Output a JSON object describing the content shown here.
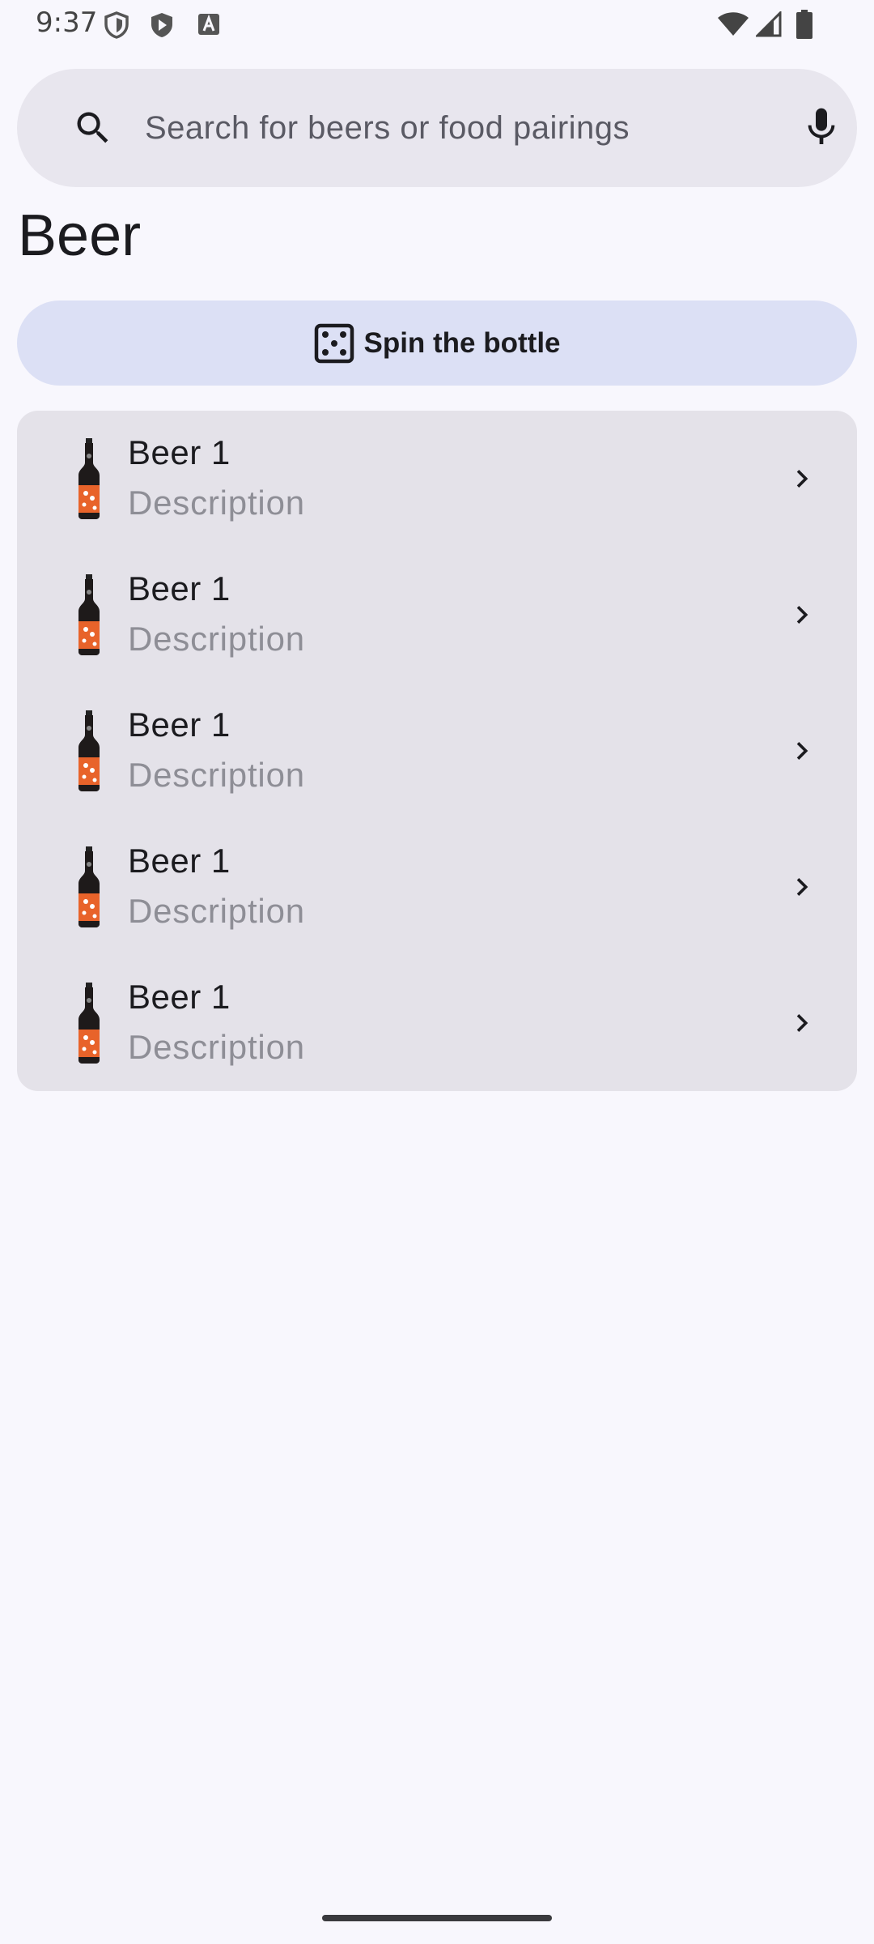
{
  "status_bar": {
    "time": "9:37",
    "icons": [
      "shield-icon",
      "play-shield-icon",
      "text-a-icon",
      "wifi-icon",
      "cellular-signal-icon",
      "battery-icon"
    ]
  },
  "search": {
    "placeholder": "Search for beers or food pairings",
    "value": ""
  },
  "page": {
    "title": "Beer"
  },
  "spin_button": {
    "label": "Spin the bottle",
    "icon": "dice-icon"
  },
  "beers": [
    {
      "name": "Beer 1",
      "description": "Description"
    },
    {
      "name": "Beer 1",
      "description": "Description"
    },
    {
      "name": "Beer 1",
      "description": "Description"
    },
    {
      "name": "Beer 1",
      "description": "Description"
    },
    {
      "name": "Beer 1",
      "description": "Description"
    }
  ],
  "colors": {
    "background": "#f8f7fd",
    "search_bar": "#e8e6ee",
    "spin_button": "#dce0f5",
    "list_card": "#e4e2e9",
    "beer_label_orange": "#e8632a"
  }
}
